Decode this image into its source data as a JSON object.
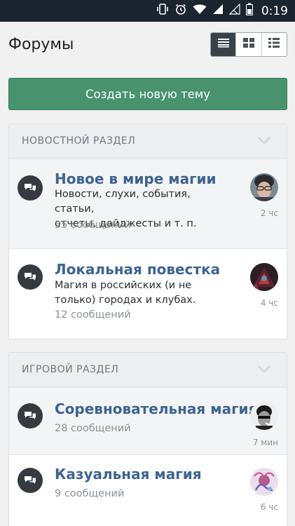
{
  "statusbar": {
    "time": "0:19"
  },
  "header": {
    "title": "Форумы"
  },
  "actions": {
    "create_topic": "Создать новую тему"
  },
  "sections": [
    {
      "title": "НОВОСТНОЙ РАЗДЕЛ",
      "forums": [
        {
          "title": "Новое в мире магии",
          "description_line1": "Новости, слухи, события, статьи,",
          "description_line2": "отчеты, дайджесты и т. п.",
          "count": "35 сообщений",
          "time": "2 чс"
        },
        {
          "title": "Локальная повестка",
          "description_line1": "Магия в российских (и не",
          "description_line2": "только) городах и клубах.",
          "count": "12 сообщений",
          "time": "4 чс"
        }
      ]
    },
    {
      "title": "ИГРОВОЙ РАЗДЕЛ",
      "forums": [
        {
          "title": "Соревновательная магия",
          "count": "28 сообщений",
          "time": "7 мин"
        },
        {
          "title": "Казуальная магия",
          "count": "9 сообщений",
          "time": "6 чс"
        }
      ]
    }
  ],
  "colors": {
    "accent": "#48926e",
    "link": "#3d6491",
    "statusbar": "#1b2530"
  }
}
